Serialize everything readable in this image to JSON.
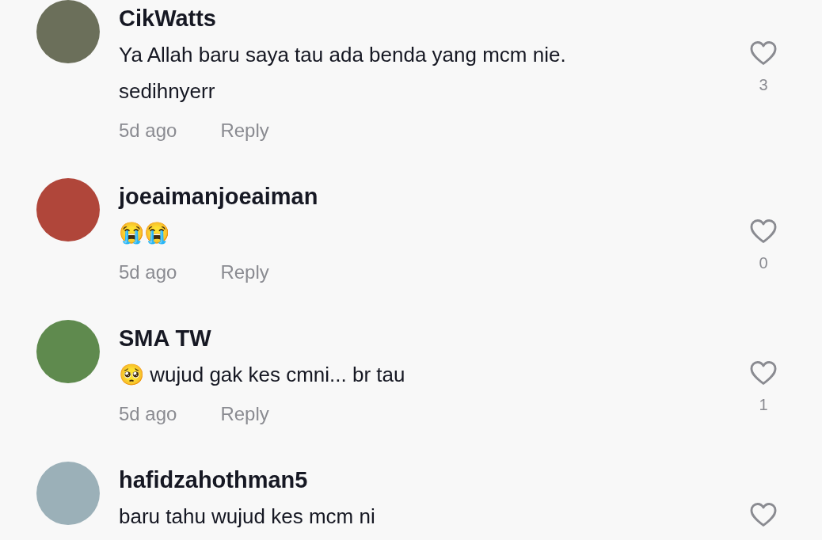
{
  "comments": [
    {
      "username": "CikWatts",
      "text_lines": [
        "Ya Allah baru saya tau ada benda yang mcm nie.",
        "sedihnyerr"
      ],
      "time": "5d ago",
      "reply": "Reply",
      "likes": "3",
      "liked": false
    },
    {
      "username": "joeaimanjoeaiman",
      "text_lines": [
        "😭😭"
      ],
      "time": "5d ago",
      "reply": "Reply",
      "likes": "0",
      "liked": false
    },
    {
      "username": "SMA TW",
      "text_lines": [
        "🥺 wujud gak kes cmni... br tau"
      ],
      "time": "5d ago",
      "reply": "Reply",
      "likes": "1",
      "liked": false
    },
    {
      "username": "hafidzahothman5",
      "text_lines": [
        "baru tahu wujud kes mcm ni"
      ],
      "liked": false
    }
  ]
}
